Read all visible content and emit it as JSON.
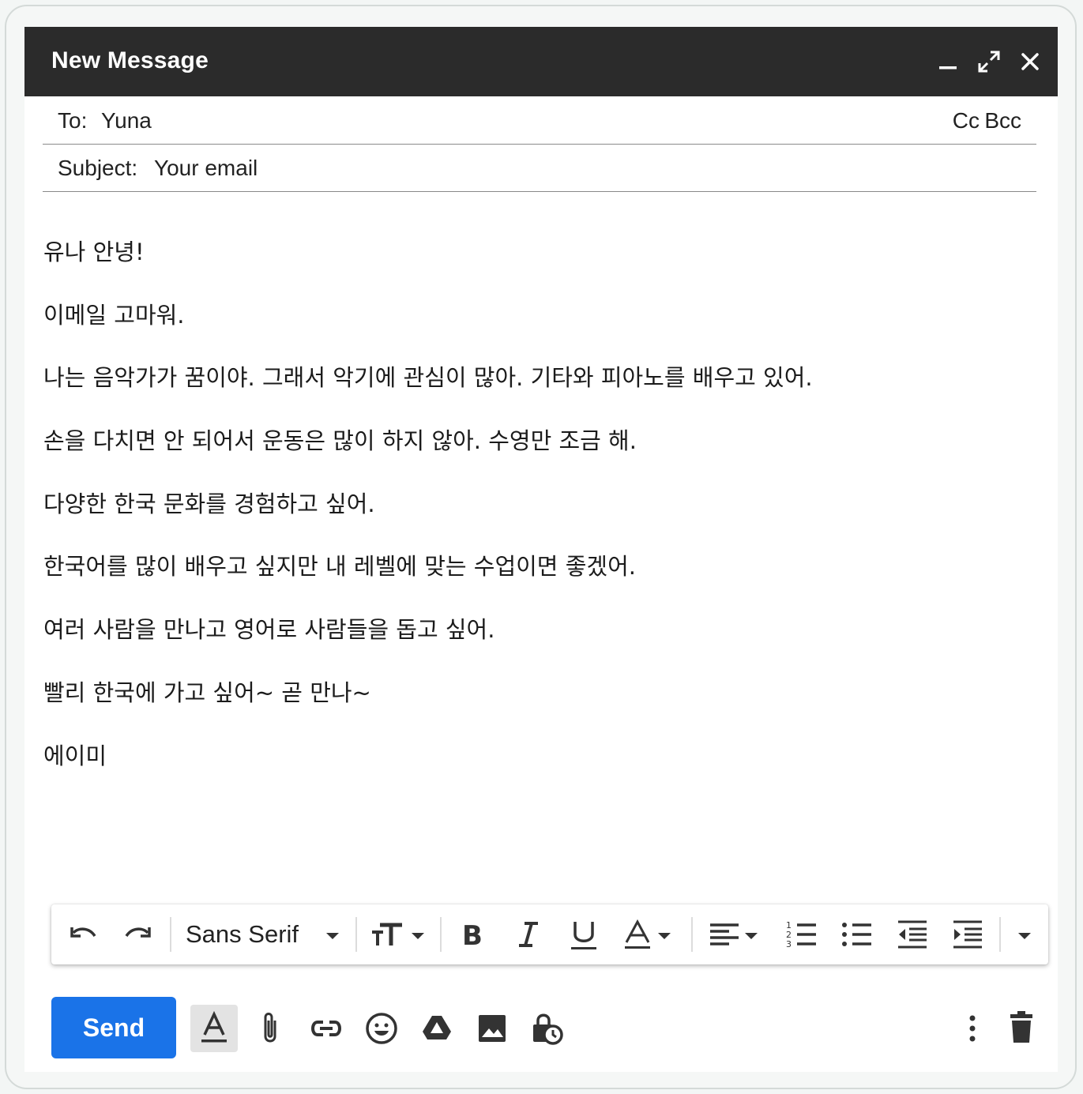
{
  "window": {
    "title": "New Message"
  },
  "titlebar_icons": [
    "minimize-icon",
    "expand-icon",
    "close-icon"
  ],
  "recipients": {
    "to_label": "To:",
    "to_value": "Yuna",
    "cc_label": "Cc",
    "bcc_label": "Bcc"
  },
  "subject": {
    "label": "Subject:",
    "value": "Your email"
  },
  "body": {
    "lines": [
      "유나 안녕!",
      "이메일 고마워.",
      "나는 음악가가 꿈이야. 그래서 악기에 관심이 많아. 기타와 피아노를 배우고 있어.",
      "손을 다치면 안 되어서 운동은 많이 하지 않아. 수영만 조금 해.",
      "다양한 한국 문화를 경험하고 싶어.",
      "한국어를 많이 배우고 싶지만 내 레벨에 맞는 수업이면 좋겠어.",
      "여러 사람을 만나고 영어로 사람들을 돕고 싶어.",
      "빨리 한국에 가고 싶어~ 곧 만나~",
      "에이미"
    ]
  },
  "formatting": {
    "font": "Sans Serif",
    "icons": [
      "undo-icon",
      "redo-icon",
      "font-dropdown-icon",
      "text-size-icon",
      "bold-icon",
      "italic-icon",
      "underline-icon",
      "text-color-icon",
      "align-icon",
      "numbered-list-icon",
      "bulleted-list-icon",
      "indent-less-icon",
      "indent-more-icon",
      "more-formatting-icon"
    ]
  },
  "actions": {
    "send_label": "Send",
    "icons": [
      "formatting-toggle-icon",
      "attach-icon",
      "link-icon",
      "emoji-icon",
      "drive-icon",
      "photo-icon",
      "confidential-mode-icon",
      "more-options-icon",
      "discard-icon"
    ]
  },
  "colors": {
    "titlebar": "#2b2b2b",
    "send_button": "#1a73e8"
  }
}
